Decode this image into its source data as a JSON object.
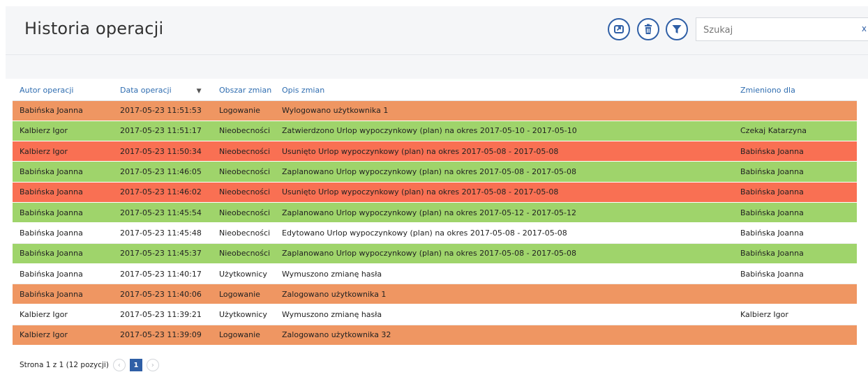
{
  "header": {
    "title": "Historia operacji",
    "search_placeholder": "Szukaj",
    "search_value": "",
    "search_clear": "x"
  },
  "table": {
    "columns": [
      "Autor operacji",
      "Data operacji",
      "Obszar zmian",
      "Opis zmian",
      "Zmieniono dla"
    ],
    "sort_indicator": "▼",
    "row_colors": {
      "orange": "#ef9662",
      "green": "#9fd46b",
      "red": "#f97053",
      "white": "#ffffff"
    },
    "rows": [
      {
        "color": "orange",
        "cells": [
          "Babińska Joanna",
          "2017-05-23 11:51:53",
          "Logowanie",
          "Wylogowano użytkownika 1",
          ""
        ]
      },
      {
        "color": "green",
        "cells": [
          "Kalbierz Igor",
          "2017-05-23 11:51:17",
          "Nieobecności",
          "Zatwierdzono Urlop wypoczynkowy (plan) na okres 2017-05-10 - 2017-05-10",
          "Czekaj Katarzyna"
        ]
      },
      {
        "color": "red",
        "cells": [
          "Kalbierz Igor",
          "2017-05-23 11:50:34",
          "Nieobecności",
          "Usunięto Urlop wypoczynkowy (plan) na okres 2017-05-08 - 2017-05-08",
          "Babińska Joanna"
        ]
      },
      {
        "color": "green",
        "cells": [
          "Babińska Joanna",
          "2017-05-23 11:46:05",
          "Nieobecności",
          "Zaplanowano Urlop wypoczynkowy (plan) na okres 2017-05-08 - 2017-05-08",
          "Babińska Joanna"
        ]
      },
      {
        "color": "red",
        "cells": [
          "Babińska Joanna",
          "2017-05-23 11:46:02",
          "Nieobecności",
          "Usunięto Urlop wypoczynkowy (plan) na okres 2017-05-08 - 2017-05-08",
          "Babińska Joanna"
        ]
      },
      {
        "color": "green",
        "cells": [
          "Babińska Joanna",
          "2017-05-23 11:45:54",
          "Nieobecności",
          "Zaplanowano Urlop wypoczynkowy (plan) na okres 2017-05-12 - 2017-05-12",
          "Babińska Joanna"
        ]
      },
      {
        "color": "white",
        "cells": [
          "Babińska Joanna",
          "2017-05-23 11:45:48",
          "Nieobecności",
          "Edytowano Urlop wypoczynkowy (plan) na okres 2017-05-08 - 2017-05-08",
          "Babińska Joanna"
        ]
      },
      {
        "color": "green",
        "cells": [
          "Babińska Joanna",
          "2017-05-23 11:45:37",
          "Nieobecności",
          "Zaplanowano Urlop wypoczynkowy (plan) na okres 2017-05-08 - 2017-05-08",
          "Babińska Joanna"
        ]
      },
      {
        "color": "white",
        "cells": [
          "Babińska Joanna",
          "2017-05-23 11:40:17",
          "Użytkownicy",
          "Wymuszono zmianę hasła",
          "Babińska Joanna"
        ]
      },
      {
        "color": "orange",
        "cells": [
          "Babińska Joanna",
          "2017-05-23 11:40:06",
          "Logowanie",
          "Zalogowano użytkownika 1",
          ""
        ]
      },
      {
        "color": "white",
        "cells": [
          "Kalbierz Igor",
          "2017-05-23 11:39:21",
          "Użytkownicy",
          "Wymuszono zmianę hasła",
          "Kalbierz Igor"
        ]
      },
      {
        "color": "orange",
        "cells": [
          "Kalbierz Igor",
          "2017-05-23 11:39:09",
          "Logowanie",
          "Zalogowano użytkownika 32",
          ""
        ]
      }
    ]
  },
  "pager": {
    "summary": "Strona 1 z 1 (12 pozycji)",
    "prev": "‹",
    "current": "1",
    "next": "›"
  },
  "icons": [
    "export-icon",
    "delete-icon",
    "filter-icon"
  ],
  "colors": {
    "accent": "#2f5fa6",
    "header_text": "#2f6db0",
    "header_bg": "#f5f6f8"
  }
}
